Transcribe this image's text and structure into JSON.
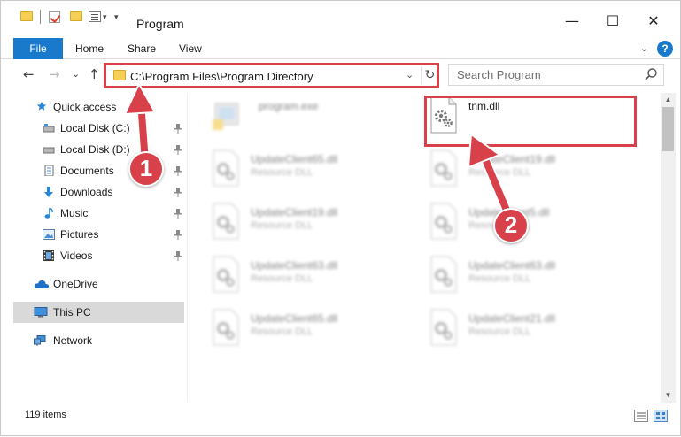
{
  "window": {
    "title": "Program",
    "controls": {
      "minimize": "—",
      "maximize": "☐",
      "close": "✕"
    }
  },
  "ribbon": {
    "tabs": [
      "File",
      "Home",
      "Share",
      "View"
    ],
    "expand_glyph": "⌄",
    "help_glyph": "?"
  },
  "navigation": {
    "back": "←",
    "forward": "→",
    "recent": "⌄",
    "up": "↑"
  },
  "address": {
    "path": "C:\\Program Files\\Program Directory",
    "dropdown_glyph": "⌄",
    "refresh_glyph": "↻"
  },
  "search": {
    "placeholder": "Search Program"
  },
  "nav_pane": {
    "items": [
      {
        "label": "Quick access",
        "icon": "star-icon",
        "pinned": false
      },
      {
        "label": "Local Disk (C:)",
        "icon": "drive-icon",
        "pinned": true
      },
      {
        "label": "Local Disk (D:)",
        "icon": "drive-icon",
        "pinned": true
      },
      {
        "label": "Documents",
        "icon": "documents-icon",
        "pinned": true
      },
      {
        "label": "Downloads",
        "icon": "downloads-icon",
        "pinned": true
      },
      {
        "label": "Music",
        "icon": "music-icon",
        "pinned": true
      },
      {
        "label": "Pictures",
        "icon": "pictures-icon",
        "pinned": true
      },
      {
        "label": "Videos",
        "icon": "videos-icon",
        "pinned": true
      },
      {
        "label": "OneDrive",
        "icon": "onedrive-icon",
        "pinned": false
      },
      {
        "label": "This PC",
        "icon": "computer-icon",
        "pinned": false,
        "selected": true
      },
      {
        "label": "Network",
        "icon": "network-icon",
        "pinned": false
      }
    ]
  },
  "files": [
    {
      "name": "program.exe",
      "type": "",
      "blurred": true,
      "icon": "exe-icon"
    },
    {
      "name": "tnm.dll",
      "type": "",
      "blurred": false,
      "icon": "dll-gear-icon"
    },
    {
      "name": "UpdateClient65.dll",
      "type": "Resource DLL",
      "blurred": true,
      "icon": "dll-gear-icon"
    },
    {
      "name": "UpdateClient19.dll",
      "type": "Resource DLL",
      "blurred": true,
      "icon": "dll-gear-icon"
    },
    {
      "name": "UpdateClient19.dll",
      "type": "Resource DLL",
      "blurred": true,
      "icon": "dll-gear-icon"
    },
    {
      "name": "UpdateClient5.dll",
      "type": "Resource DLL",
      "blurred": true,
      "icon": "dll-gear-icon"
    },
    {
      "name": "UpdateClient63.dll",
      "type": "Resource DLL",
      "blurred": true,
      "icon": "dll-gear-icon"
    },
    {
      "name": "UpdateClient63.dll",
      "type": "Resource DLL",
      "blurred": true,
      "icon": "dll-gear-icon"
    },
    {
      "name": "UpdateClient65.dll",
      "type": "Resource DLL",
      "blurred": true,
      "icon": "dll-gear-icon"
    },
    {
      "name": "UpdateClient21.dll",
      "type": "Resource DLL",
      "blurred": true,
      "icon": "dll-gear-icon"
    }
  ],
  "status": {
    "item_count": "119 items"
  },
  "scrollbar": {
    "up": "▲",
    "down": "▼"
  },
  "annotations": {
    "step1": "1",
    "step2": "2",
    "highlight_color": "#d9414a"
  },
  "colors": {
    "accent": "#1979ca",
    "selection": "#d9d9d9",
    "annotation": "#d9414a"
  }
}
